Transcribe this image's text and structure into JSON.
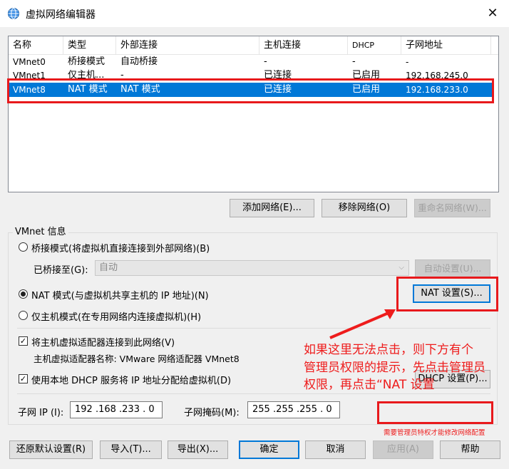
{
  "window": {
    "title": "虚拟网络编辑器",
    "close": "✕"
  },
  "list": {
    "headers": [
      "名称",
      "类型",
      "外部连接",
      "主机连接",
      "DHCP",
      "子网地址"
    ],
    "rows": [
      [
        "VMnet0",
        "桥接模式",
        "自动桥接",
        "-",
        "-",
        "-"
      ],
      [
        "VMnet1",
        "仅主机...",
        "-",
        "已连接",
        "已启用",
        "192.168.245.0"
      ],
      [
        "VMnet8",
        "NAT 模式",
        "NAT 模式",
        "已连接",
        "已启用",
        "192.168.233.0"
      ]
    ],
    "selected_row": 2
  },
  "list_buttons": {
    "add": "添加网络(E)...",
    "remove": "移除网络(O)",
    "rename": "重命名网络(W)..."
  },
  "info": {
    "group_label": "VMnet 信息",
    "bridged": "桥接模式(将虚拟机直接连接到外部网络)(B)",
    "bridged_to_label": "已桥接至(G):",
    "bridged_to_value": "自动",
    "auto_settings": "自动设置(U)...",
    "nat": "NAT 模式(与虚拟机共享主机的 IP 地址)(N)",
    "nat_settings": "NAT 设置(S)...",
    "hostonly": "仅主机模式(在专用网络内连接虚拟机)(H)",
    "selected_mode": "nat",
    "connect_adapter": "将主机虚拟适配器连接到此网络(V)",
    "connect_adapter_checked": true,
    "adapter_name": "主机虚拟适配器名称: VMware 网络适配器 VMnet8",
    "use_dhcp": "使用本地 DHCP 服务将 IP 地址分配给虚拟机(D)",
    "use_dhcp_checked": true,
    "dhcp_settings": "DHCP 设置(P)...",
    "subnet_ip_label": "子网 IP (I):",
    "subnet_ip": "192 .168 .233 .  0",
    "subnet_mask_label": "子网掩码(M):",
    "subnet_mask": "255 .255 .255 .  0"
  },
  "footer": {
    "restore": "还原默认设置(R)",
    "import": "导入(T)...",
    "export": "导出(X)...",
    "ok": "确定",
    "cancel": "取消",
    "apply": "应用(A)",
    "help": "帮助"
  },
  "annotation": {
    "line1": "如果这里无法点击，则下方有个",
    "line2": "管理员权限的提示，先点击管理员",
    "line3": "权限，再点击“NAT 设置",
    "admin_warning": "需要管理员特权才能修改网络配置",
    "color": "#ee1c1c"
  },
  "colors": {
    "selection": "#0078d7",
    "accent": "#0078d7",
    "window_bg": "#f0f0f0"
  }
}
